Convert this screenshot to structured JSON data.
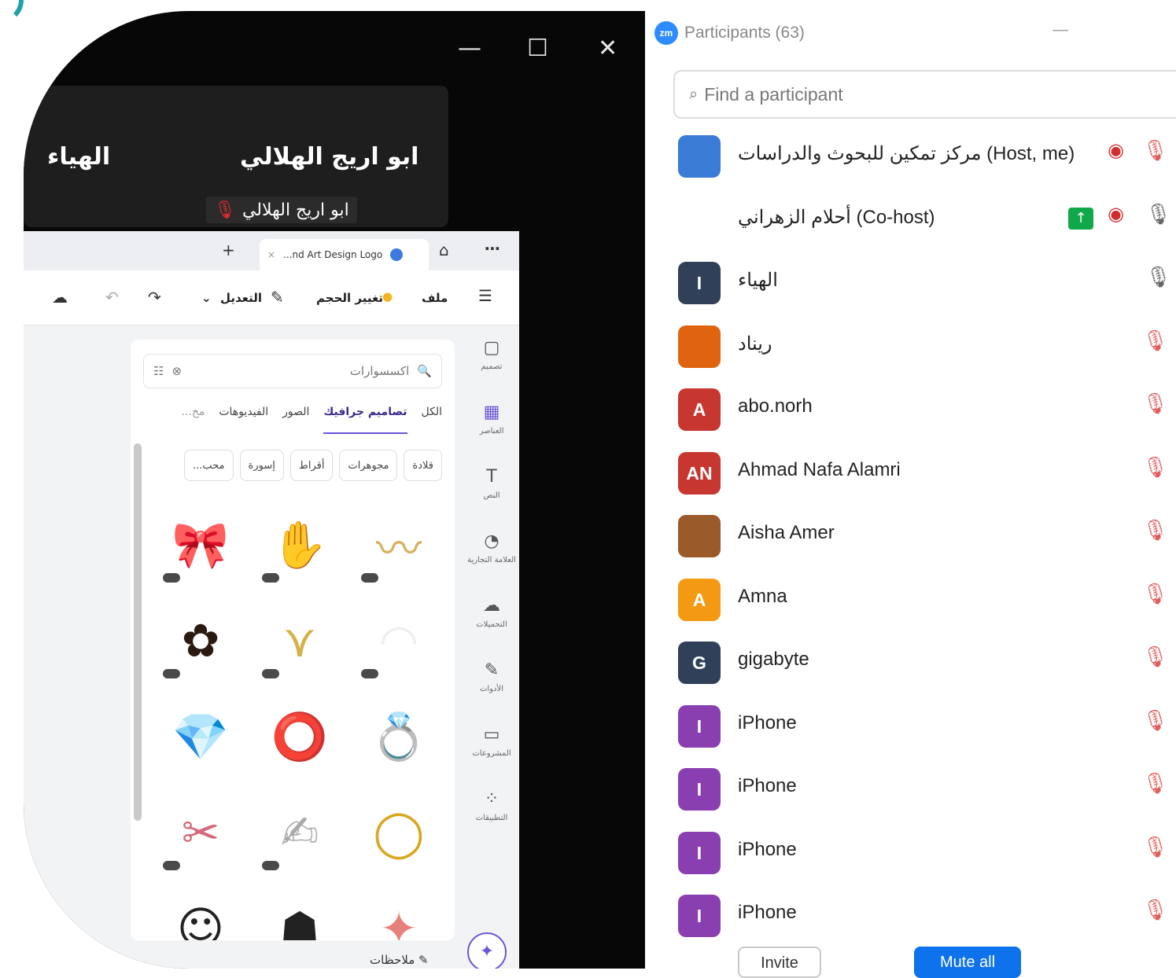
{
  "zoom": {
    "tile_name_left": "الهياء",
    "tile_name_right": "ابو اريج الهلالي",
    "tile_label": "ابو اريج الهلالي"
  },
  "canva": {
    "tab_title": "...nd Art Design Logo",
    "toolbar": {
      "file": "ملف",
      "resize": "تغيير الحجم",
      "edit": "التعديل"
    },
    "search_placeholder": "اكسسوارات",
    "categories": [
      "الكل",
      "تصاميم جرافيك",
      "الصور",
      "الفيديوهات",
      "مخ..."
    ],
    "chips": [
      "قلادة",
      "مجوهرات",
      "أقراط",
      "إسورة",
      "محب..."
    ],
    "rail": [
      {
        "icon": "▢",
        "label": "تصميم"
      },
      {
        "icon": "▦",
        "label": "العناصر"
      },
      {
        "icon": "T",
        "label": "النص"
      },
      {
        "icon": "◔",
        "label": "العلامة التجارية"
      },
      {
        "icon": "☁",
        "label": "التحميلات"
      },
      {
        "icon": "✎",
        "label": "الأدوات"
      },
      {
        "icon": "▭",
        "label": "المشروعات"
      },
      {
        "icon": "⁘",
        "label": "التطبيقات"
      }
    ],
    "grid": [
      "🎀",
      "✋",
      "〰",
      "✿",
      "⋎",
      "◠",
      "💎",
      "⭕",
      "💍",
      "✂",
      "✍",
      "◯",
      "☺",
      "☗",
      "✦"
    ],
    "notes": "ملاحظات"
  },
  "participants": {
    "title": "Participants (63)",
    "search_placeholder": "Find a participant",
    "list": [
      {
        "name": "مركز تمكين للبحوث والدراسات (Host, me)",
        "initials": "",
        "color": "#3a7bd5",
        "icons": [
          "eye",
          "mic-muted"
        ]
      },
      {
        "name": "أحلام الزهراني (Co-host)",
        "initials": "",
        "color": "#ffffff",
        "icons": [
          "share",
          "eye",
          "mic-on"
        ]
      },
      {
        "name": "الهياء",
        "initials": "I",
        "color": "#2f4058",
        "icons": [
          "mic-on"
        ]
      },
      {
        "name": "ريناد",
        "initials": "",
        "color": "#e0640f",
        "icons": [
          "mic-muted"
        ]
      },
      {
        "name": "abo.norh",
        "initials": "A",
        "color": "#c8372f",
        "icons": [
          "mic-muted"
        ]
      },
      {
        "name": "Ahmad Nafa Alamri",
        "initials": "AN",
        "color": "#c8372f",
        "icons": [
          "mic-muted"
        ]
      },
      {
        "name": "Aisha Amer",
        "initials": "",
        "color": "#9a5a2a",
        "icons": [
          "mic-muted"
        ]
      },
      {
        "name": "Amna",
        "initials": "A",
        "color": "#f39a12",
        "icons": [
          "mic-muted"
        ]
      },
      {
        "name": "gigabyte",
        "initials": "G",
        "color": "#2f4058",
        "icons": [
          "mic-muted"
        ]
      },
      {
        "name": "iPhone",
        "initials": "I",
        "color": "#8a3fb0",
        "icons": [
          "mic-muted"
        ]
      },
      {
        "name": "iPhone",
        "initials": "I",
        "color": "#8a3fb0",
        "icons": [
          "mic-muted"
        ]
      },
      {
        "name": "iPhone",
        "initials": "I",
        "color": "#8a3fb0",
        "icons": [
          "mic-muted"
        ]
      },
      {
        "name": "iPhone",
        "initials": "I",
        "color": "#8a3fb0",
        "icons": [
          "mic-muted"
        ]
      }
    ],
    "invite": "Invite",
    "mute_all": "Mute all"
  }
}
